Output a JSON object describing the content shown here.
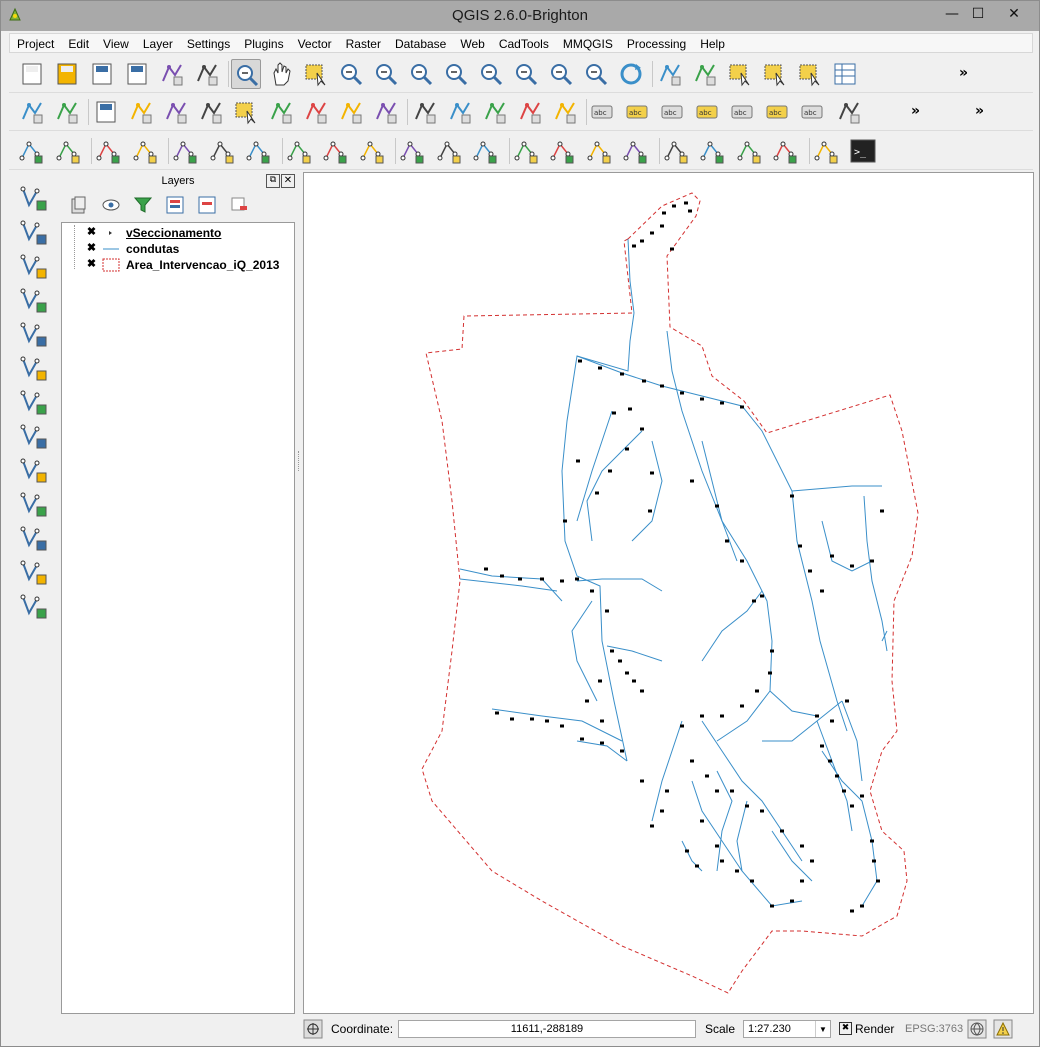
{
  "window": {
    "title": "QGIS 2.6.0-Brighton",
    "min": "—",
    "max": "☐",
    "close": "✕"
  },
  "menu": [
    "Project",
    "Edit",
    "View",
    "Layer",
    "Settings",
    "Plugins",
    "Vector",
    "Raster",
    "Database",
    "Web",
    "CadTools",
    "MMQGIS",
    "Processing",
    "Help"
  ],
  "toolbar_icons": {
    "row1": [
      "new-project-icon",
      "open-project-icon",
      "save-project-icon",
      "save-as-icon",
      "new-print-composer-icon",
      "composer-manager-icon",
      "touch-zoom-icon",
      "pan-icon",
      "pan-to-selection-icon",
      "zoom-in-icon",
      "zoom-out-icon",
      "zoom-actual-icon",
      "zoom-full-icon",
      "zoom-to-selection-icon",
      "zoom-to-layer-icon",
      "zoom-last-icon",
      "zoom-next-icon",
      "refresh-icon",
      "identify-icon",
      "run-action-icon",
      "select-icon",
      "deselect-icon",
      "expression-select-icon",
      "attribute-table-icon",
      "statistics-icon",
      "help-icon"
    ],
    "row2": [
      "digitize-icon",
      "edit-pencil-icon",
      "save-edits-icon",
      "add-point-icon",
      "add-polygon-icon",
      "node-tool-icon",
      "delete-selected-icon",
      "cut-icon",
      "copy-icon",
      "paste-icon",
      "move-feature-icon",
      "crosshair-icon",
      "coordinate-capture-icon",
      "align-icon",
      "trace-icon",
      "snap-icon",
      "label-icon",
      "label-pin-icon",
      "label-show-icon",
      "label-move-icon",
      "label-rotate-icon",
      "label-change-icon",
      "label-properties-icon",
      "gps-icon",
      "plugin-icon",
      "csw-icon"
    ],
    "row3": [
      "cad-1",
      "cad-2",
      "cad-3",
      "cad-4",
      "cad-5",
      "cad-6",
      "cad-7",
      "cad-8",
      "cad-9",
      "cad-10",
      "cad-11",
      "cad-12",
      "cad-13",
      "cad-14",
      "cad-15",
      "cad-16",
      "cad-17",
      "cad-18",
      "cad-19",
      "cad-20",
      "cad-21",
      "cad-22",
      "python-console-icon"
    ]
  },
  "layers": {
    "title": "Layers",
    "items": [
      {
        "name": "vSeccionamento",
        "checked": "✖",
        "type": "point"
      },
      {
        "name": "condutas",
        "checked": "✖",
        "type": "line"
      },
      {
        "name": "Area_Intervencao_iQ_2013",
        "checked": "✖",
        "type": "polygon"
      }
    ]
  },
  "status": {
    "coordinate_label": "Coordinate:",
    "coordinate_value": "11611,-288189",
    "scale_label": "Scale",
    "scale_value": "1:27.230",
    "render_label": "Render",
    "render_checked": "✖",
    "crs": "EPSG:3763"
  },
  "colors": {
    "pipe": "#3a8fc9",
    "boundary": "#d33030",
    "points": "#000000"
  }
}
